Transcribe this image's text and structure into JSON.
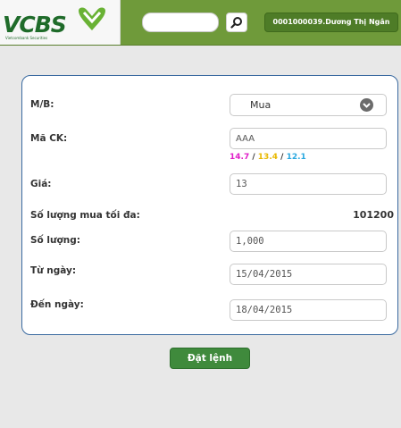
{
  "header": {
    "logo_text": "VCBS",
    "logo_subtext": "Vietcombank Securities",
    "search_value": "",
    "user_label": "0001000039.Dương Thị Ngân"
  },
  "form": {
    "mb": {
      "label": "M/B:",
      "value": "Mua"
    },
    "symbol": {
      "label": "Mã CK:",
      "value": "AAA"
    },
    "ref_prices": {
      "ceiling": "14.7",
      "reference": "13.4",
      "floor": "12.1",
      "separator": "/"
    },
    "price": {
      "label": "Giá:",
      "value": "13"
    },
    "max_qty": {
      "label": "Số lượng mua tối đa:",
      "value": "101200"
    },
    "qty": {
      "label": "Số lượng:",
      "value": "1,000"
    },
    "from_date": {
      "label": "Từ ngày:",
      "value": "15/04/2015"
    },
    "to_date": {
      "label": "Đến ngày:",
      "value": "18/04/2015"
    },
    "submit_label": "Đặt lệnh"
  },
  "colors": {
    "header_bg": "#6f9a3a",
    "ceiling": "#e020c8",
    "reference": "#e8b800",
    "floor": "#29a8e0",
    "submit_bg": "#3f8a3c",
    "panel_border": "#3a6aa0"
  },
  "icons": {
    "search": "search-icon",
    "dropdown": "chevron-down-icon"
  }
}
